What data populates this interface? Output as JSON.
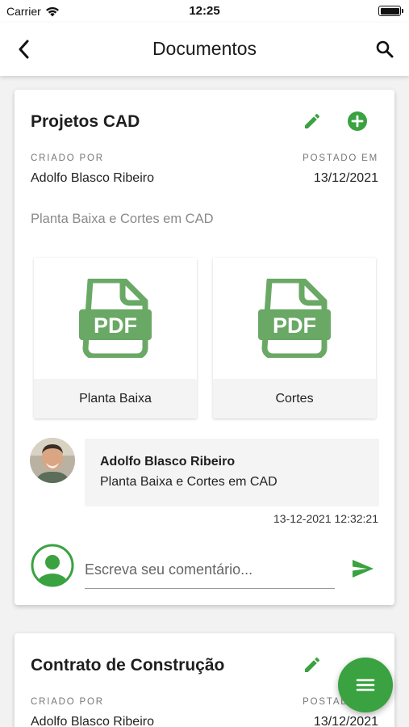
{
  "status_bar": {
    "carrier": "Carrier",
    "time": "12:25"
  },
  "app_bar": {
    "title": "Documentos"
  },
  "colors": {
    "accent": "#3aa241",
    "pdf_icon": "#6aa865"
  },
  "documents": [
    {
      "title": "Projetos CAD",
      "created_by_label": "CRIADO POR",
      "created_by": "Adolfo Blasco Ribeiro",
      "posted_label": "POSTADO EM",
      "posted_date": "13/12/2021",
      "description": "Planta Baixa e Cortes em CAD",
      "files": [
        {
          "name": "Planta Baixa",
          "icon": "pdf-file-icon"
        },
        {
          "name": "Cortes",
          "icon": "pdf-file-icon"
        }
      ],
      "comment": {
        "author": "Adolfo Blasco Ribeiro",
        "text": "Planta Baixa e Cortes em CAD",
        "timestamp": "13-12-2021 12:32:21"
      },
      "comment_input": {
        "placeholder": "Escreva seu comentário..."
      }
    },
    {
      "title": "Contrato de Construção",
      "created_by_label": "CRIADO POR",
      "created_by": "Adolfo Blasco Ribeiro",
      "posted_label": "POSTADO EM",
      "posted_date": "13/12/2021"
    }
  ]
}
